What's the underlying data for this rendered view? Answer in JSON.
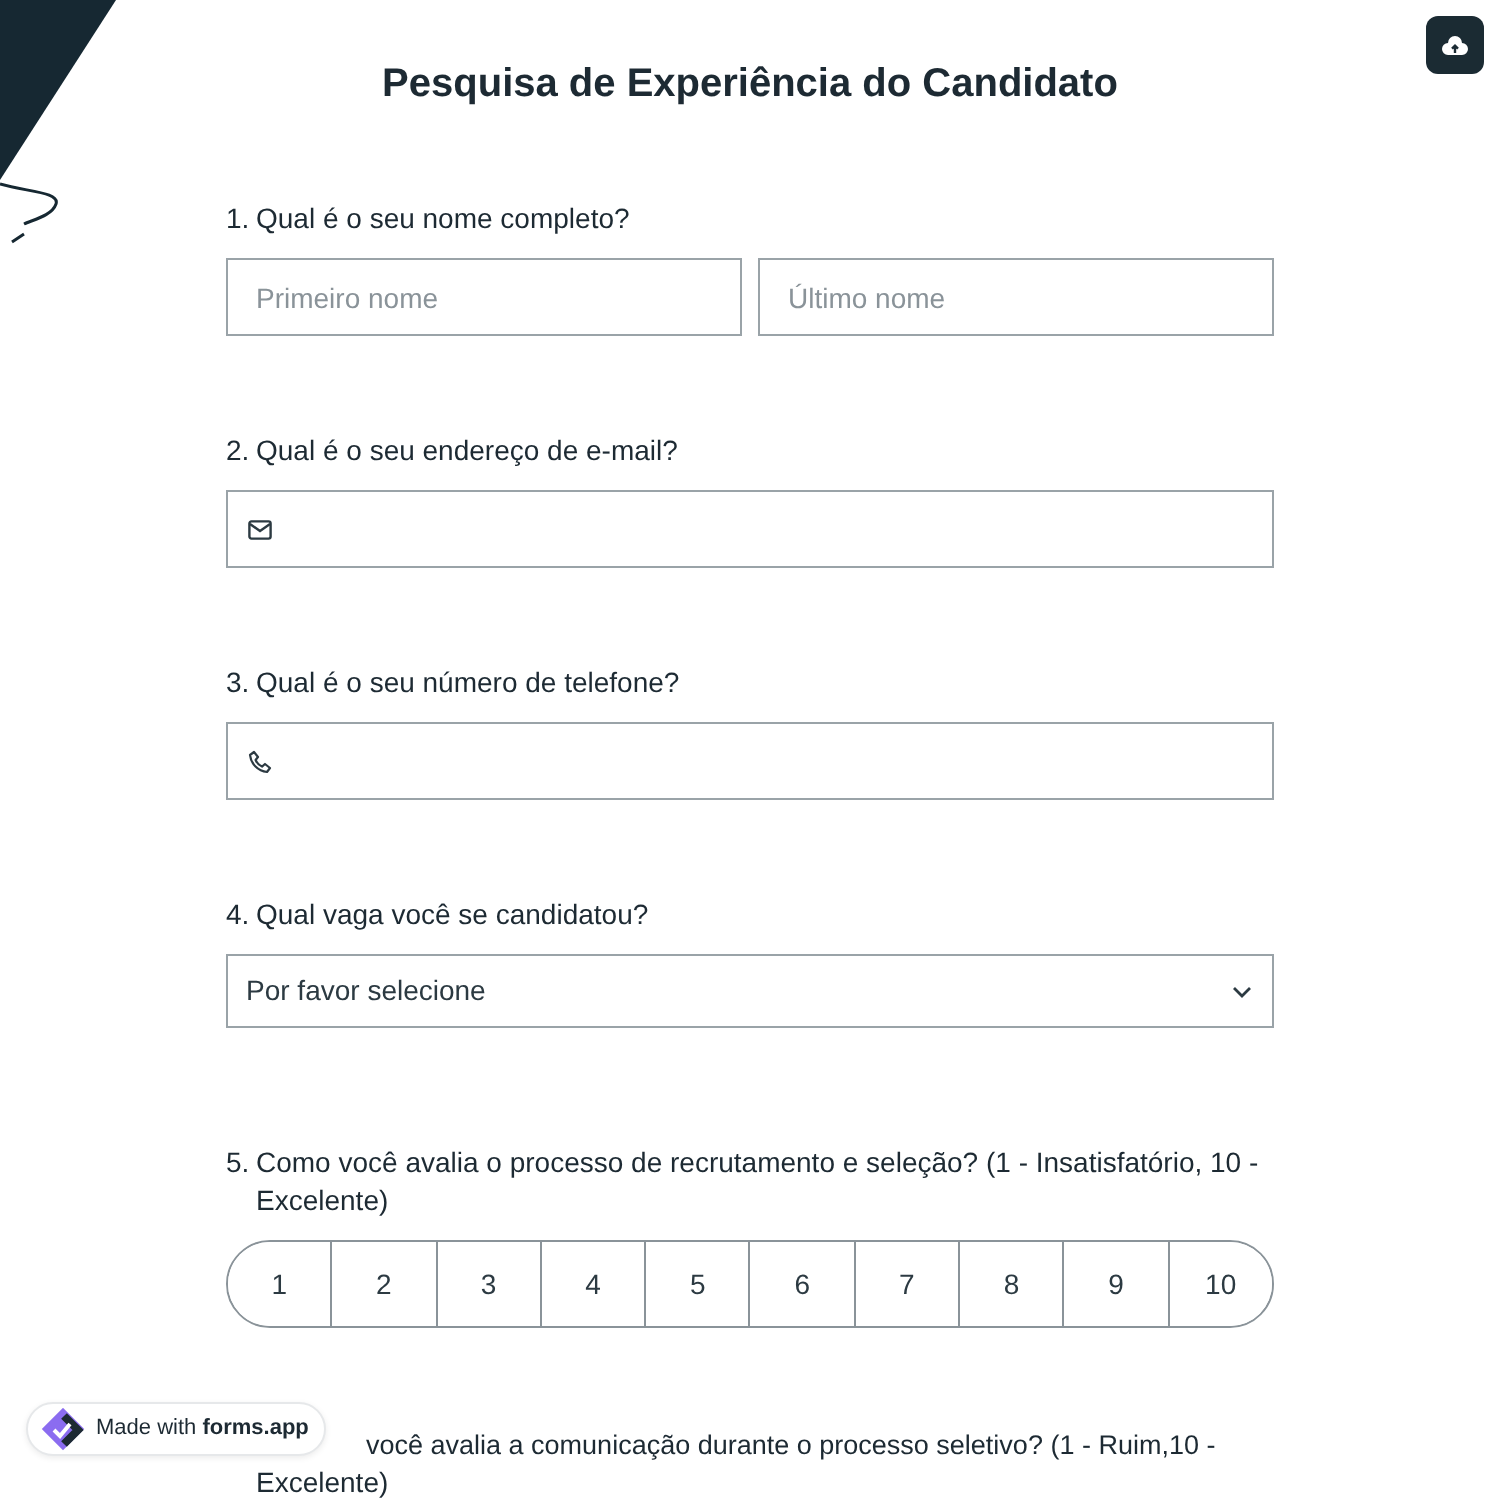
{
  "title": "Pesquisa de Experiência do Candidato",
  "questions": [
    {
      "kind": "name",
      "number": "1.",
      "label": "Qual é o seu nome completo?",
      "fields": [
        {
          "placeholder": "Primeiro nome"
        },
        {
          "placeholder": "Último nome"
        }
      ]
    },
    {
      "kind": "email",
      "number": "2.",
      "label": "Qual é o seu endereço de e-mail?"
    },
    {
      "kind": "phone",
      "number": "3.",
      "label": "Qual é o seu número de telefone?"
    },
    {
      "kind": "select",
      "number": "4.",
      "label": "Qual vaga você se candidatou?",
      "value": "Por favor selecione"
    },
    {
      "kind": "scale",
      "number": "5.",
      "label": "Como você avalia o processo de recrutamento e seleção? (1 - Insatisfatório, 10 - Excelente)",
      "options": [
        "1",
        "2",
        "3",
        "4",
        "5",
        "6",
        "7",
        "8",
        "9",
        "10"
      ]
    },
    {
      "kind": "partial",
      "lines": [
        "você avalia a comunicação durante o processo seletivo? (1 - Ruim,10 -",
        "Excelente)"
      ]
    }
  ],
  "badge": {
    "text": "Made with **forms.app**"
  }
}
